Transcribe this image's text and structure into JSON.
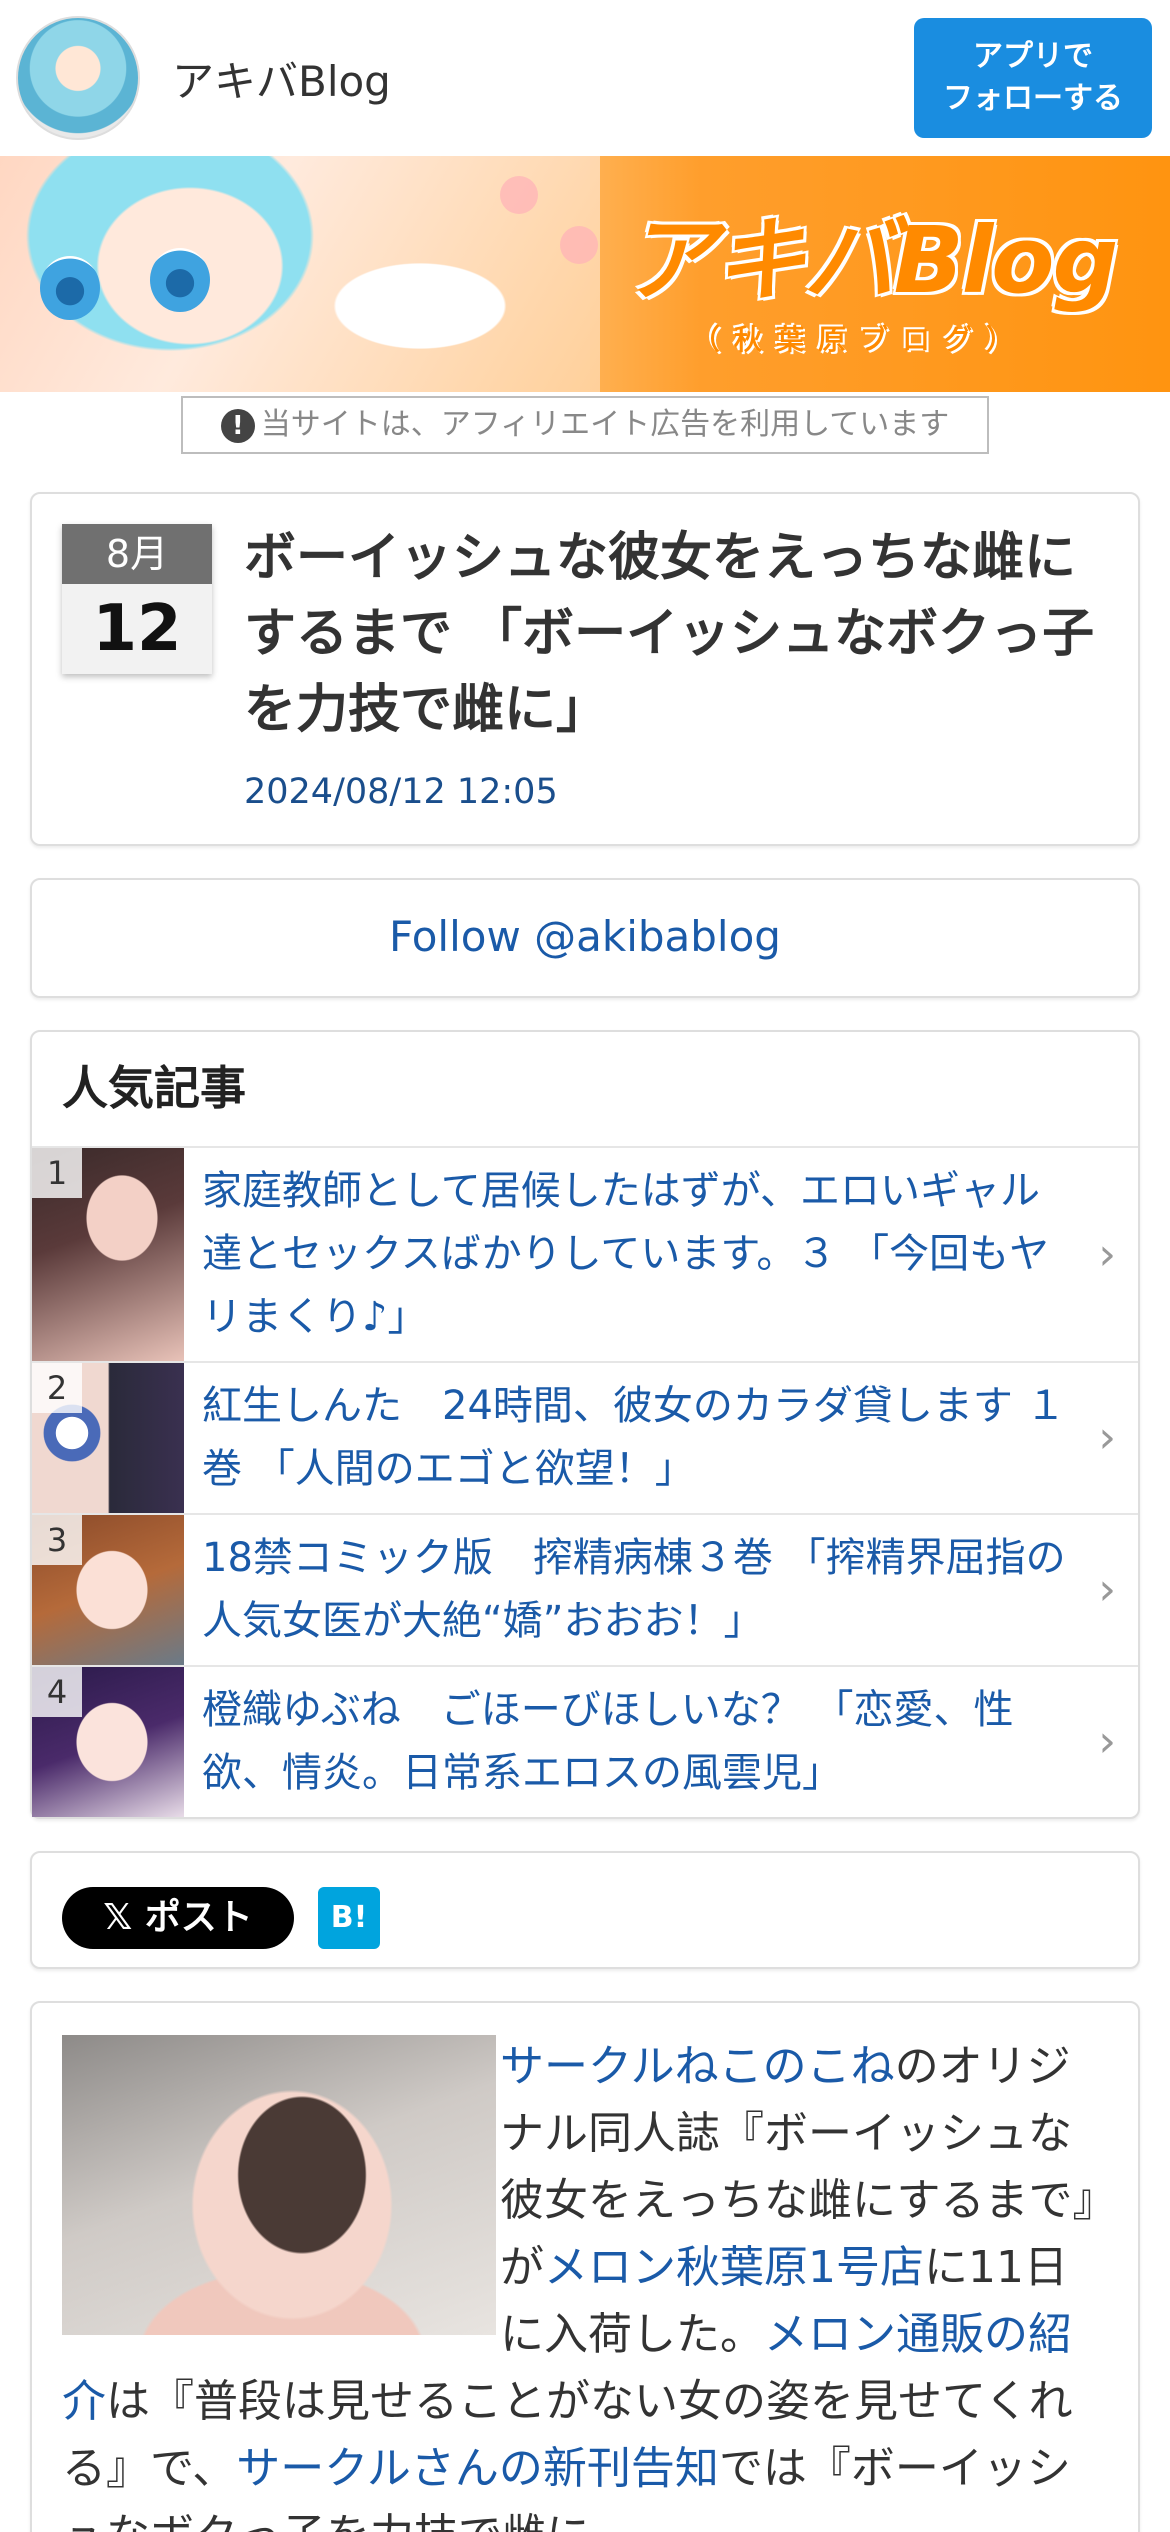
{
  "header": {
    "site_name": "アキバBlog",
    "follow_app_button": "アプリで\nフォローする"
  },
  "banner": {
    "logo_text": "アキバBlog",
    "logo_sub": "（秋葉原ブログ）"
  },
  "ad_notice": "当サイトは、アフィリエイト広告を利用しています",
  "article": {
    "month": "8月",
    "day": "12",
    "title": "ボーイッシュな彼女をえっちな雌にするまで 「ボーイッシュなボクっ子を力技で雌に」",
    "datetime": "2024/08/12 12:05"
  },
  "follow_link": "Follow @akibablog",
  "popular": {
    "heading": "人気記事",
    "items": [
      {
        "rank": "1",
        "title": "家庭教師として居候したはずが、エロいギャル達とセックスばかりしています。３ 「今回もヤリまくり♪」"
      },
      {
        "rank": "2",
        "title": "紅生しんた　24時間、彼女のカラダ貸します １巻 「人間のエゴと欲望！」"
      },
      {
        "rank": "3",
        "title": "18禁コミック版　搾精病棟３巻 「搾精界屈指の人気女医が大絶“嬌”おおお！」"
      },
      {
        "rank": "4",
        "title": "橙織ゆぶね　ごほーびほしいな？ 「恋愛、性欲、情炎。日常系エロスの風雲児」"
      }
    ]
  },
  "share": {
    "x_post": "ポスト",
    "hatena": "B!"
  },
  "body": {
    "link1": "サークルねこのこね",
    "text1": "のオリジナル同人誌『ボーイッシュな彼女をえっちな雌にするまで』が",
    "link2": "メロン秋葉原1号店",
    "text2": "に11日に入荷した。",
    "link3": "メロン通販の紹介",
    "text3": "は『普段は見せることがない女の姿を見せてくれる』で、",
    "link4": "サークルさんの新刊告知",
    "text4": "では『ボーイッシュなボクっ子を力技で雌に"
  }
}
